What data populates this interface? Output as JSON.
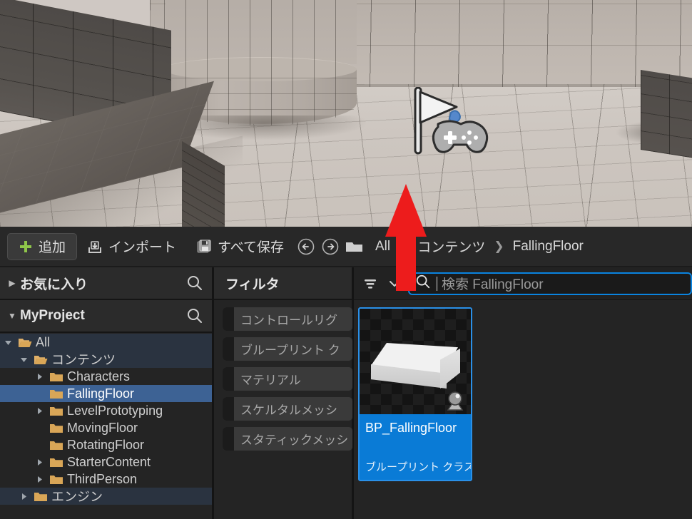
{
  "toolbar": {
    "add_label": "追加",
    "import_label": "インポート",
    "save_all_label": "すべて保存",
    "back_tooltip": "戻る",
    "forward_tooltip": "進む",
    "breadcrumb": [
      {
        "label": "All"
      },
      {
        "label": "コンテンツ"
      },
      {
        "label": "FallingFloor"
      }
    ],
    "separator": "❯"
  },
  "sources": {
    "favorites": {
      "label": "お気に入り",
      "expanded": false,
      "search_icon": "search-icon"
    },
    "project": {
      "label": "MyProject",
      "expanded": true,
      "search_icon": "search-icon"
    },
    "tree": [
      {
        "label": "All",
        "depth": 0,
        "expanded": true,
        "has_children": true,
        "selected": false,
        "open_folder": true
      },
      {
        "label": "コンテンツ",
        "depth": 1,
        "expanded": true,
        "has_children": true,
        "selected": false,
        "open_folder": true
      },
      {
        "label": "Characters",
        "depth": 2,
        "expanded": false,
        "has_children": true,
        "selected": false,
        "open_folder": false
      },
      {
        "label": "FallingFloor",
        "depth": 2,
        "expanded": false,
        "has_children": false,
        "selected": true,
        "open_folder": false
      },
      {
        "label": "LevelPrototyping",
        "depth": 2,
        "expanded": false,
        "has_children": true,
        "selected": false,
        "open_folder": false
      },
      {
        "label": "MovingFloor",
        "depth": 2,
        "expanded": false,
        "has_children": false,
        "selected": false,
        "open_folder": false
      },
      {
        "label": "RotatingFloor",
        "depth": 2,
        "expanded": false,
        "has_children": false,
        "selected": false,
        "open_folder": false
      },
      {
        "label": "StarterContent",
        "depth": 2,
        "expanded": false,
        "has_children": true,
        "selected": false,
        "open_folder": false
      },
      {
        "label": "ThirdPerson",
        "depth": 2,
        "expanded": false,
        "has_children": true,
        "selected": false,
        "open_folder": false
      },
      {
        "label": "エンジン",
        "depth": 1,
        "expanded": false,
        "has_children": true,
        "selected": false,
        "open_folder": false
      }
    ]
  },
  "filters": {
    "title": "フィルタ",
    "items": [
      {
        "label": "コントロールリグ"
      },
      {
        "label": "ブループリント ク"
      },
      {
        "label": "マテリアル"
      },
      {
        "label": "スケルタルメッシ"
      },
      {
        "label": "スタティックメッシ"
      }
    ]
  },
  "assets": {
    "search_placeholder": "検索 FallingFloor",
    "search_value": "",
    "funnel_icon": "filter-funnel-icon",
    "chevron_icon": "chevron-down-icon",
    "search_icon": "search-icon",
    "tiles": [
      {
        "name": "BP_FallingFloor",
        "type": "ブループリント クラス",
        "selected": true,
        "badge_icon": "blueprint-thumbnail-badge-icon"
      }
    ]
  },
  "viewport": {
    "actor_icon": "player-start-icon"
  },
  "annotation": {
    "arrow_icon": "red-up-arrow-annotation",
    "arrow_color": "#ED1C1C"
  },
  "colors": {
    "accent_blue": "#0a7bd6",
    "selection_blue": "#3d6294",
    "focus_outline": "#0a84e0",
    "panel_bg": "#242424",
    "toolbar_bg": "#282828",
    "add_green": "#8fc54a",
    "folder_tan": "#d9a657"
  }
}
